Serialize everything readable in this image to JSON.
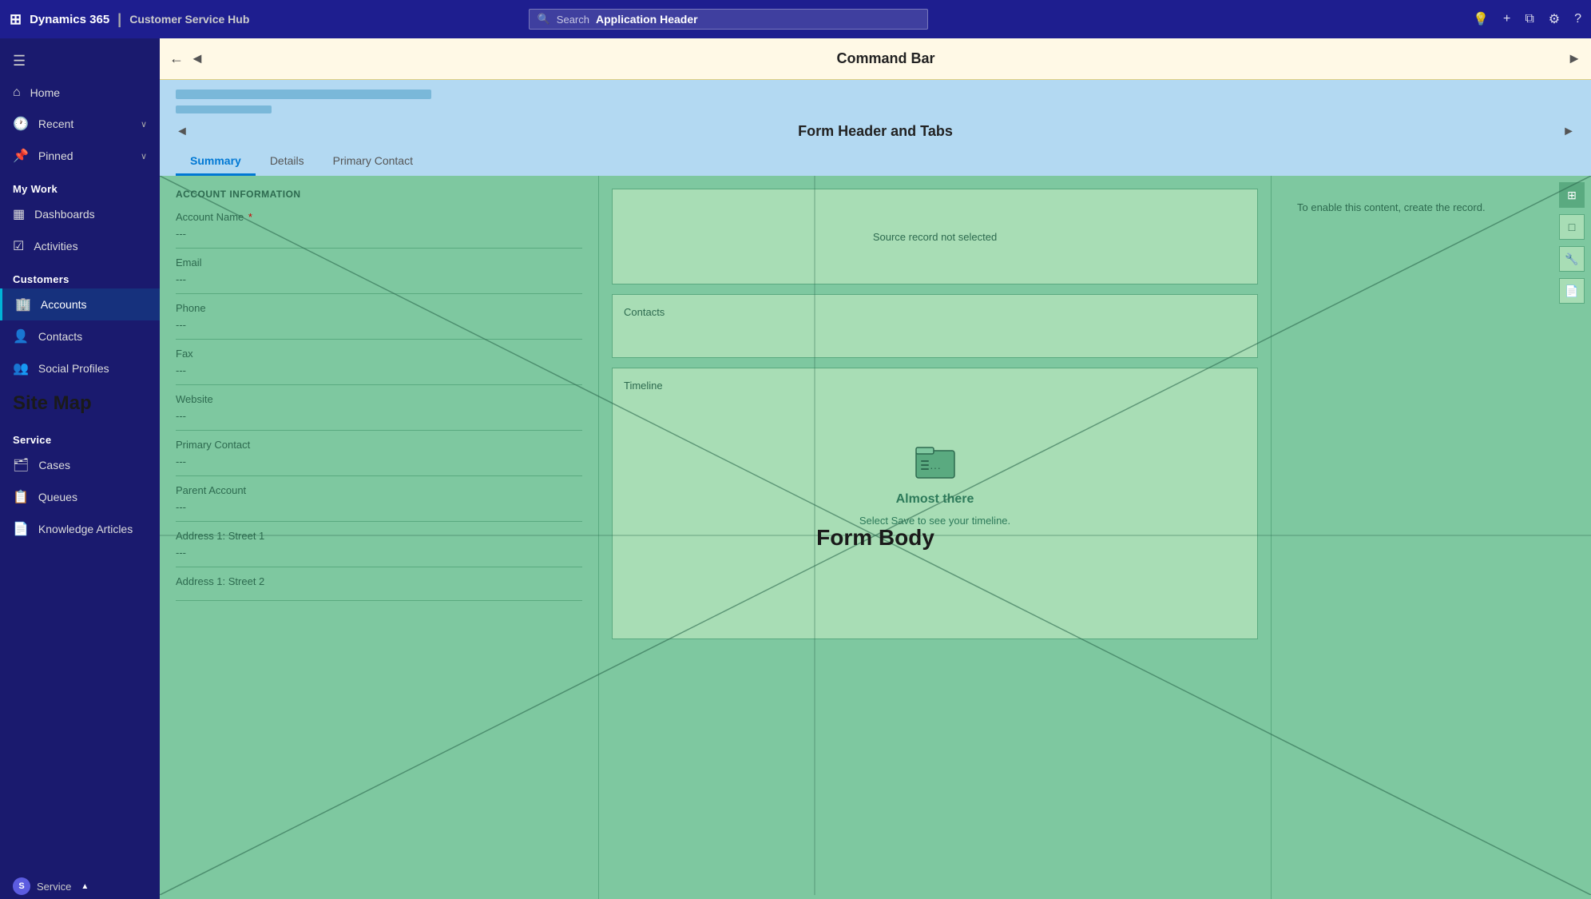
{
  "appHeader": {
    "brand": "Dynamics 365",
    "divider": "|",
    "app": "Customer Service Hub",
    "searchPlaceholder": "Search",
    "headerLabel": "Application Header",
    "icons": {
      "bulb": "💡",
      "plus": "+",
      "filter": "⧉",
      "settings": "⚙",
      "help": "?"
    }
  },
  "commandBar": {
    "backIcon": "←",
    "arrowLeft": "◄",
    "label": "Command Bar",
    "arrowRight": "►"
  },
  "formHeader": {
    "arrowLeft": "◄",
    "label": "Form Header and Tabs",
    "arrowRight": "►",
    "tabs": [
      {
        "id": "summary",
        "label": "Summary",
        "active": true
      },
      {
        "id": "details",
        "label": "Details",
        "active": false
      },
      {
        "id": "primaryContact",
        "label": "Primary Contact",
        "active": false
      }
    ]
  },
  "sidebar": {
    "toggleIcon": "☰",
    "navItems": [
      {
        "id": "home",
        "icon": "⌂",
        "label": "Home",
        "hasChevron": false
      },
      {
        "id": "recent",
        "icon": "🕐",
        "label": "Recent",
        "hasChevron": true
      },
      {
        "id": "pinned",
        "icon": "📌",
        "label": "Pinned",
        "hasChevron": true
      }
    ],
    "myWorkLabel": "My Work",
    "myWorkItems": [
      {
        "id": "dashboards",
        "icon": "▦",
        "label": "Dashboards"
      },
      {
        "id": "activities",
        "icon": "☑",
        "label": "Activities"
      }
    ],
    "customersLabel": "Customers",
    "customersItems": [
      {
        "id": "accounts",
        "icon": "🏢",
        "label": "Accounts",
        "active": true
      },
      {
        "id": "contacts",
        "icon": "👤",
        "label": "Contacts"
      },
      {
        "id": "social-profiles",
        "icon": "👥",
        "label": "Social Profiles"
      }
    ],
    "siteMapLabel": "Site Map",
    "serviceLabel": "Service",
    "serviceItems": [
      {
        "id": "cases",
        "icon": "🗂",
        "label": "Cases"
      },
      {
        "id": "queues",
        "icon": "📋",
        "label": "Queues"
      },
      {
        "id": "knowledge-articles",
        "icon": "📄",
        "label": "Knowledge Articles"
      }
    ],
    "statusBar": {
      "avatarLabel": "S",
      "serviceLabel": "Service",
      "chevron": "▲"
    }
  },
  "formBody": {
    "label": "Form Body",
    "accountInfo": {
      "sectionTitle": "ACCOUNT INFORMATION",
      "fields": [
        {
          "id": "account-name",
          "label": "Account Name",
          "required": true,
          "value": "---"
        },
        {
          "id": "email",
          "label": "Email",
          "required": false,
          "value": "---"
        },
        {
          "id": "phone",
          "label": "Phone",
          "required": false,
          "value": "---"
        },
        {
          "id": "fax",
          "label": "Fax",
          "required": false,
          "value": "---"
        },
        {
          "id": "website",
          "label": "Website",
          "required": false,
          "value": "---"
        },
        {
          "id": "primary-contact",
          "label": "Primary Contact",
          "required": false,
          "value": "---"
        },
        {
          "id": "parent-account",
          "label": "Parent Account",
          "required": false,
          "value": "---"
        },
        {
          "id": "address1-street1",
          "label": "Address 1: Street 1",
          "required": false,
          "value": "---"
        },
        {
          "id": "address1-street2",
          "label": "Address 1: Street 2",
          "required": false,
          "value": ""
        }
      ]
    },
    "middle": {
      "sourceNotSelected": "Source record not selected",
      "contactsLabel": "Contacts",
      "timelineLabel": "Timeline",
      "timelineIcon": "📁",
      "almostThereTitle": "Almost there",
      "almostThereSub": "Select Save to see your timeline."
    },
    "rightPanel": {
      "enableMsg": "To enable this content, create the record.",
      "icons": [
        {
          "id": "grid-icon",
          "symbol": "⊞",
          "active": true
        },
        {
          "id": "square-icon",
          "symbol": "□",
          "active": false
        },
        {
          "id": "wrench-icon",
          "symbol": "🔧",
          "active": false
        },
        {
          "id": "doc-icon",
          "symbol": "📄",
          "active": false
        }
      ]
    }
  }
}
